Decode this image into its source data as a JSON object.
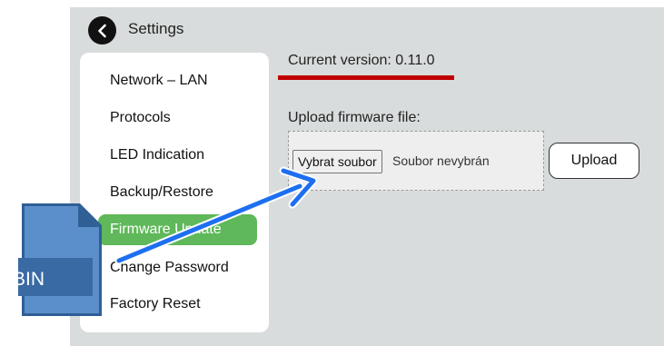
{
  "header": {
    "title": "Settings",
    "back_icon": "chevron-left-icon"
  },
  "menu": {
    "items": [
      {
        "label": "Network – LAN"
      },
      {
        "label": "Protocols"
      },
      {
        "label": "LED Indication"
      },
      {
        "label": "Backup/Restore"
      },
      {
        "label": "Firmware Update",
        "active": true
      },
      {
        "label": "Change Password"
      },
      {
        "label": "Factory Reset"
      }
    ]
  },
  "main": {
    "version_text": "Current version: 0.11.0",
    "upload_label": "Upload firmware file:",
    "choose_file_label": "Vybrat soubor",
    "no_file_text": "Soubor nevybrán",
    "upload_button_label": "Upload"
  },
  "overlay": {
    "file_icon_label": "BIN",
    "arrow_color": "#1e6ff0"
  },
  "colors": {
    "active_item": "#5fb85a",
    "underline": "#c00000",
    "panel_bg": "#d9dcdc",
    "file_icon": "#4f7fb8"
  }
}
